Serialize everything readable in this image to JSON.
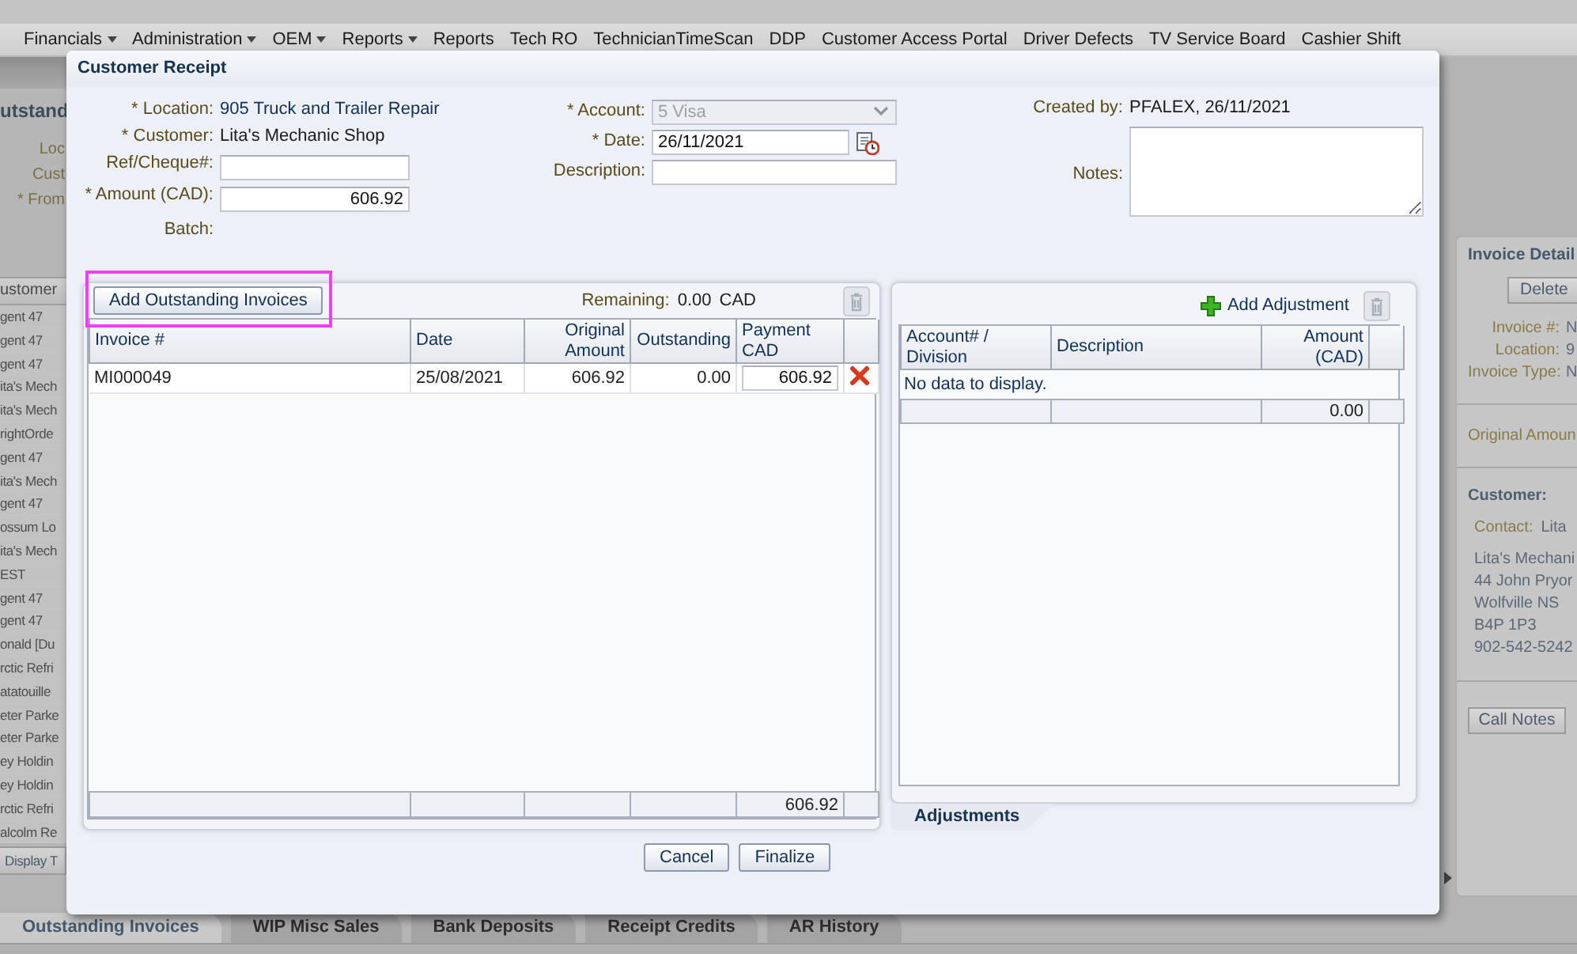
{
  "top_menu": [
    {
      "label": "Financials",
      "dropdown": true
    },
    {
      "label": "Administration",
      "dropdown": true
    },
    {
      "label": "OEM",
      "dropdown": true
    },
    {
      "label": "Reports",
      "dropdown": true
    },
    {
      "label": "Reports",
      "dropdown": false
    },
    {
      "label": "Tech RO",
      "dropdown": false
    },
    {
      "label": "TechnicianTimeScan",
      "dropdown": false
    },
    {
      "label": "DDP",
      "dropdown": false
    },
    {
      "label": "Customer Access Portal",
      "dropdown": false
    },
    {
      "label": "Driver Defects",
      "dropdown": false
    },
    {
      "label": "TV Service Board",
      "dropdown": false
    },
    {
      "label": "Cashier Shift",
      "dropdown": false
    }
  ],
  "left_panel": {
    "title": "utstand",
    "filters": [
      "Loc",
      "Cust",
      "* From"
    ],
    "column_header": "ustomer",
    "rows": [
      "gent 47",
      "gent 47",
      "gent 47",
      "ita's Mech",
      "ita's Mech",
      "rightOrde",
      "gent 47",
      "ita's Mech",
      "gent 47",
      "ossum Lo",
      "ita's Mech",
      "EST",
      "gent 47",
      "gent 47",
      "onald [Du",
      "rctic Refri",
      "atatouille",
      "eter Parke",
      "eter Parke",
      "ey Holdin",
      "ey Holdin",
      "rctic Refri",
      "alcolm Re"
    ],
    "button": "Display T"
  },
  "right_panel": {
    "title": "Invoice Detail",
    "delete_button": "Delete",
    "fields": [
      {
        "label": "Invoice #:",
        "value": "N"
      },
      {
        "label": "Location:",
        "value": "9"
      },
      {
        "label": "Invoice Type:",
        "value": "N"
      }
    ],
    "original_amount_label": "Original Amoun",
    "customer_heading": "Customer:",
    "contact_label": "Contact:",
    "contact_value": "Lita",
    "address_lines": [
      "Lita's Mechani",
      "44 John Pryor",
      "Wolfville NS",
      "B4P 1P3",
      "902-542-5242"
    ],
    "call_notes_button": "Call Notes"
  },
  "bottom_tabs": [
    {
      "label": "Outstanding Invoices",
      "selected": true
    },
    {
      "label": "WIP Misc Sales",
      "selected": false
    },
    {
      "label": "Bank Deposits",
      "selected": false
    },
    {
      "label": "Receipt Credits",
      "selected": false
    },
    {
      "label": "AR History",
      "selected": false
    }
  ],
  "dialog": {
    "title": "Customer Receipt",
    "column_1": [
      {
        "label": "* Location:",
        "kind": "text",
        "value": "905 Truck and Trailer Repair"
      },
      {
        "label": "* Customer:",
        "kind": "text",
        "value": "Lita's Mechanic Shop"
      },
      {
        "label": "Ref/Cheque#:",
        "kind": "input",
        "disabled": false
      },
      {
        "label": "* Amount (CAD):",
        "kind": "input",
        "value": "606.92",
        "disabled": false
      },
      {
        "label": "Batch:",
        "kind": "text"
      }
    ],
    "column_2": [
      {
        "label": "* Account:",
        "kind": "select",
        "value": "5 Visa",
        "disabled": true
      },
      {
        "label": "* Date:",
        "kind": "date",
        "value": "26/11/2021",
        "disabled": false
      },
      {
        "label": "Description:",
        "kind": "input",
        "disabled": false
      }
    ],
    "column_3": [
      {
        "label": "Created by:",
        "kind": "text",
        "value": "PFALEX, 26/11/2021"
      },
      {
        "label": "Notes:",
        "kind": "textarea",
        "disabled": false
      }
    ],
    "invoices": {
      "add_button": {
        "label": "Add Outstanding Invoices",
        "highlighted": true
      },
      "remaining_label": "Remaining:",
      "remaining_value": "0.00",
      "remaining_currency": "CAD",
      "columns": [
        "Invoice #",
        "Date",
        "Original Amount",
        "Outstanding",
        "Payment CAD"
      ],
      "rows": [
        {
          "cells": [
            "MI000049",
            "25/08/2021",
            "606.92",
            "0.00"
          ],
          "payment": "606.92"
        }
      ],
      "total_payment": "606.92"
    },
    "adjustments": {
      "add_button": "Add Adjustment",
      "columns": [
        "Account# / Division",
        "Description",
        "Amount (CAD)"
      ],
      "empty_message": "No data to display.",
      "total_amount": "0.00",
      "tab": "Adjustments"
    },
    "buttons": [
      "Cancel",
      "Finalize"
    ]
  }
}
